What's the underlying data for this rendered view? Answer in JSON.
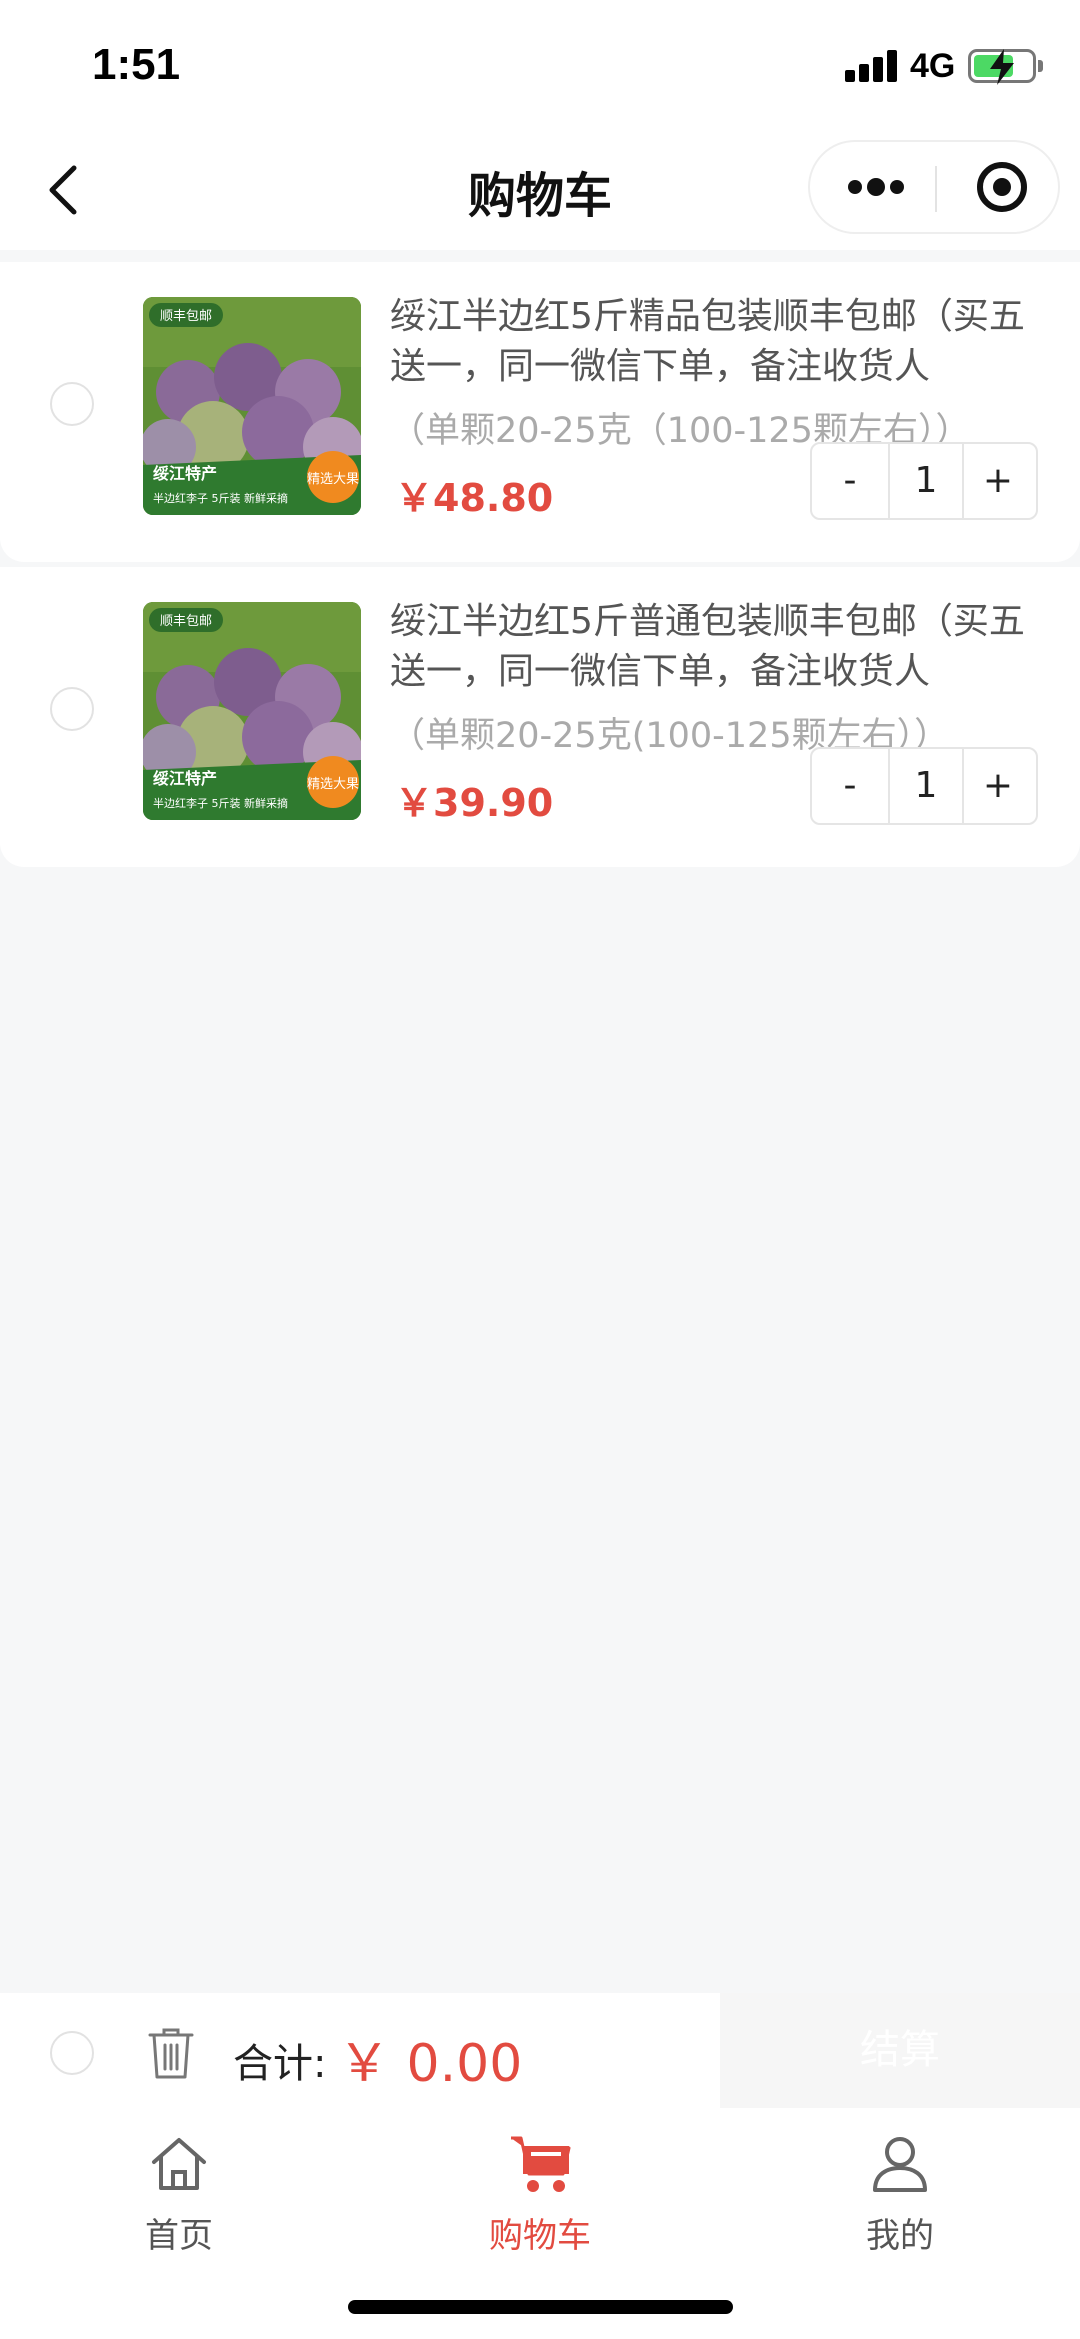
{
  "status_bar": {
    "time": "1:51",
    "network": "4G",
    "battery_level": 0.7,
    "battery_color": "#4cd964"
  },
  "nav": {
    "title": "购物车",
    "back_icon": "chevron-left-icon",
    "more_icon": "more-dots-icon",
    "close_icon": "target-circle-icon"
  },
  "cart": {
    "items": [
      {
        "title": "绥江半边红5斤精品包装顺丰包邮（买五送一，同一微信下单，备注收货人",
        "spec": "（单颗20-25克（100-125颗左右））",
        "price": "￥48.80",
        "quantity": "1",
        "minus_label": "-",
        "plus_label": "+",
        "image": {
          "badge_top": "顺丰包邮",
          "badge_region": "绥江特产",
          "badge_round": "精选大果",
          "caption": "半边红李子 5斤装 新鲜采摘"
        }
      },
      {
        "title": "绥江半边红5斤普通包装顺丰包邮（买五送一，同一微信下单，备注收货人",
        "spec": "（单颗20-25克(100-125颗左右））",
        "price": "￥39.90",
        "quantity": "1",
        "minus_label": "-",
        "plus_label": "+",
        "image": {
          "badge_top": "顺丰包邮",
          "badge_region": "绥江特产",
          "badge_round": "精选大果",
          "caption": "半边红李子 5斤装 新鲜采摘"
        }
      }
    ]
  },
  "summary": {
    "total_label": "合计:",
    "total_value": "￥ 0.00",
    "checkout_label": "结算",
    "trash_icon": "trash-icon"
  },
  "tabbar": {
    "home_label": "首页",
    "cart_label": "购物车",
    "mine_label": "我的",
    "active": "cart",
    "active_color": "#e24b40"
  }
}
